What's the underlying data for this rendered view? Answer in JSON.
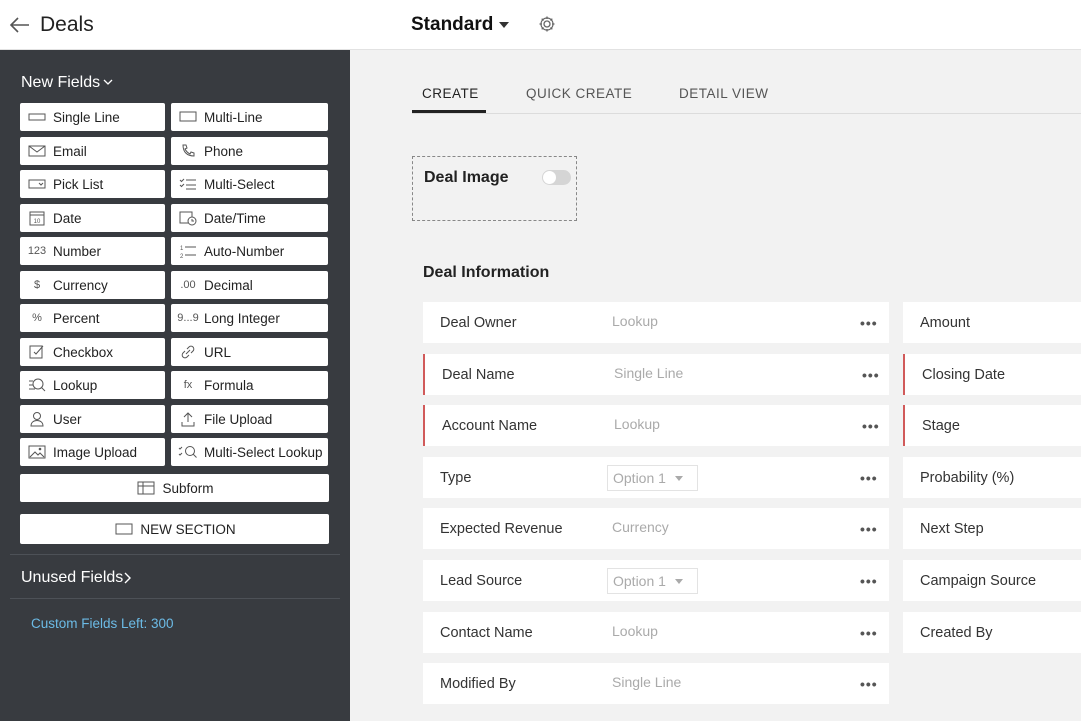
{
  "header": {
    "title": "Deals",
    "layout_name": "Standard"
  },
  "sidebar": {
    "new_fields_label": "New Fields",
    "fields": [
      {
        "label": "Single Line",
        "icon": "single-line-icon"
      },
      {
        "label": "Multi-Line",
        "icon": "multi-line-icon"
      },
      {
        "label": "Email",
        "icon": "email-icon"
      },
      {
        "label": "Phone",
        "icon": "phone-icon"
      },
      {
        "label": "Pick List",
        "icon": "pick-list-icon"
      },
      {
        "label": "Multi-Select",
        "icon": "multi-select-icon"
      },
      {
        "label": "Date",
        "icon": "date-icon"
      },
      {
        "label": "Date/Time",
        "icon": "date-time-icon"
      },
      {
        "label": "Number",
        "icon": "number-icon",
        "glyph": "123"
      },
      {
        "label": "Auto-Number",
        "icon": "auto-number-icon"
      },
      {
        "label": "Currency",
        "icon": "currency-icon",
        "glyph": "$"
      },
      {
        "label": "Decimal",
        "icon": "decimal-icon",
        "glyph": ".00"
      },
      {
        "label": "Percent",
        "icon": "percent-icon",
        "glyph": "%"
      },
      {
        "label": "Long Integer",
        "icon": "long-integer-icon",
        "glyph": "9...9"
      },
      {
        "label": "Checkbox",
        "icon": "checkbox-icon"
      },
      {
        "label": "URL",
        "icon": "url-icon"
      },
      {
        "label": "Lookup",
        "icon": "lookup-icon"
      },
      {
        "label": "Formula",
        "icon": "formula-icon",
        "glyph": "fx"
      },
      {
        "label": "User",
        "icon": "user-icon"
      },
      {
        "label": "File Upload",
        "icon": "file-upload-icon"
      },
      {
        "label": "Image Upload",
        "icon": "image-upload-icon"
      },
      {
        "label": "Multi-Select Lookup",
        "icon": "multi-select-lookup-icon"
      }
    ],
    "subform_label": "Subform",
    "new_section_label": "NEW SECTION",
    "unused_fields_label": "Unused Fields",
    "custom_fields_left": "Custom Fields Left: 300"
  },
  "tabs": [
    "CREATE",
    "QUICK CREATE",
    "DETAIL VIEW"
  ],
  "deal_image": {
    "label": "Deal Image",
    "enabled": false
  },
  "section": {
    "title": "Deal Information",
    "left_fields": [
      {
        "label": "Deal Owner",
        "placeholder": "Lookup",
        "mandatory": false,
        "kind": "text"
      },
      {
        "label": "Deal Name",
        "placeholder": "Single Line",
        "mandatory": true,
        "kind": "text"
      },
      {
        "label": "Account Name",
        "placeholder": "Lookup",
        "mandatory": true,
        "kind": "text"
      },
      {
        "label": "Type",
        "placeholder": "Option 1",
        "mandatory": false,
        "kind": "select"
      },
      {
        "label": "Expected Revenue",
        "placeholder": "Currency",
        "mandatory": false,
        "kind": "text"
      },
      {
        "label": "Lead Source",
        "placeholder": "Option 1",
        "mandatory": false,
        "kind": "select"
      },
      {
        "label": "Contact Name",
        "placeholder": "Lookup",
        "mandatory": false,
        "kind": "text"
      },
      {
        "label": "Modified By",
        "placeholder": "Single Line",
        "mandatory": false,
        "kind": "text"
      }
    ],
    "right_fields": [
      {
        "label": "Amount",
        "mandatory": false
      },
      {
        "label": "Closing Date",
        "mandatory": true
      },
      {
        "label": "Stage",
        "mandatory": true
      },
      {
        "label": "Probability (%)",
        "mandatory": false
      },
      {
        "label": "Next Step",
        "mandatory": false
      },
      {
        "label": "Campaign Source",
        "mandatory": false
      },
      {
        "label": "Created By",
        "mandatory": false
      }
    ],
    "more_glyph": "•••"
  }
}
